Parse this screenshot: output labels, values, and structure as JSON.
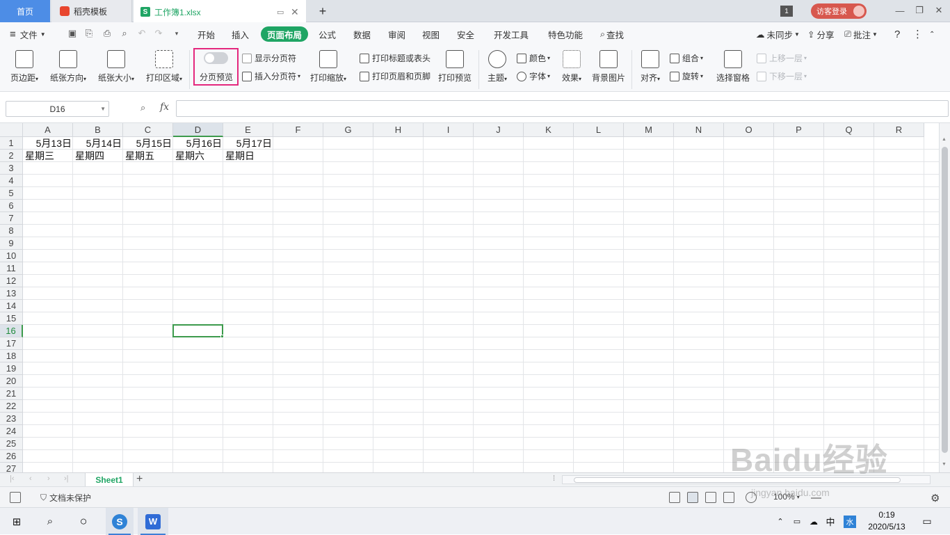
{
  "tabs": {
    "home": "首页",
    "template": "稻壳模板",
    "doc_name": "工作簿1.xlsx",
    "doc_icon": "S",
    "add": "+",
    "badge": "1",
    "login": "访客登录"
  },
  "menu": {
    "file": "文件",
    "items": [
      "开始",
      "插入",
      "页面布局",
      "公式",
      "数据",
      "审阅",
      "视图",
      "安全",
      "开发工具",
      "特色功能"
    ],
    "search": "查找",
    "sync": "未同步",
    "share": "分享",
    "comment": "批注",
    "help": "?"
  },
  "ribbon": {
    "margins": "页边距",
    "orientation": "纸张方向",
    "size": "纸张大小",
    "print_area": "打印区域",
    "page_preview": "分页预览",
    "show_breaks": "显示分页符",
    "insert_break": "插入分页符",
    "print_scale": "打印缩放",
    "print_titles": "打印标题或表头",
    "header_footer": "打印页眉和页脚",
    "print_preview": "打印预览",
    "theme": "主题",
    "colors": "颜色",
    "fonts": "字体",
    "effects": "效果",
    "bg_image": "背景图片",
    "align": "对齐",
    "group": "组合",
    "rotate": "旋转",
    "select_pane": "选择窗格",
    "bring_forward": "上移一层",
    "send_backward": "下移一层"
  },
  "formula": {
    "name_box": "D16",
    "fx": "fx",
    "content": ""
  },
  "sheet": {
    "columns": [
      "A",
      "B",
      "C",
      "D",
      "E",
      "F",
      "G",
      "H",
      "I",
      "J",
      "K",
      "L",
      "M",
      "N",
      "O",
      "P",
      "Q",
      "R"
    ],
    "rows": [
      "1",
      "2",
      "3",
      "4",
      "5",
      "6",
      "7",
      "8",
      "9",
      "10",
      "11",
      "12",
      "13",
      "14",
      "15",
      "16",
      "17",
      "18",
      "19",
      "20",
      "21",
      "22",
      "23",
      "24",
      "25",
      "26",
      "27"
    ],
    "selected_cell": "D16",
    "row1": [
      "5月13日",
      "5月14日",
      "5月15日",
      "5月16日",
      "5月17日"
    ],
    "row2": [
      "星期三",
      "星期四",
      "星期五",
      "星期六",
      "星期日"
    ],
    "tab_name": "Sheet1"
  },
  "status": {
    "protect": "文档未保护",
    "zoom": "100%"
  },
  "taskbar": {
    "time": "0:19",
    "date": "2020/5/13",
    "ime": "中",
    "ime2": "水"
  },
  "watermark": {
    "brand": "Baidu经验",
    "url": "jingyan.baidu.com"
  }
}
